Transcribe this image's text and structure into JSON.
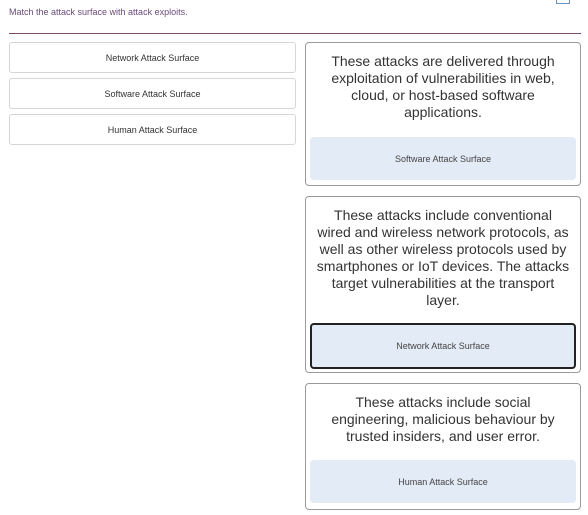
{
  "instruction": "Match the attack surface with attack exploits.",
  "options": [
    {
      "label": "Network Attack Surface"
    },
    {
      "label": "Software Attack Surface"
    },
    {
      "label": "Human Attack Surface"
    }
  ],
  "targets": [
    {
      "description": "These attacks are delivered through exploitation of vulnerabilities in web, cloud, or host-based software applications.",
      "answer": "Software Attack Surface"
    },
    {
      "description": "These attacks include conventional wired and wireless network protocols, as well as other wireless protocols used by smartphones or IoT devices. The attacks target vulnerabilities at the transport layer.",
      "answer": "Network Attack Surface"
    },
    {
      "description": "These attacks include social engineering, malicious behaviour by trusted insiders, and user error.",
      "answer": "Human Attack Surface"
    }
  ],
  "icons": {
    "corner": "window-corner-icon"
  },
  "colors": {
    "drop_zone_bg": "#e3ebf6",
    "divider": "#7b4a6e",
    "instruction_text": "#6b4a7a"
  }
}
